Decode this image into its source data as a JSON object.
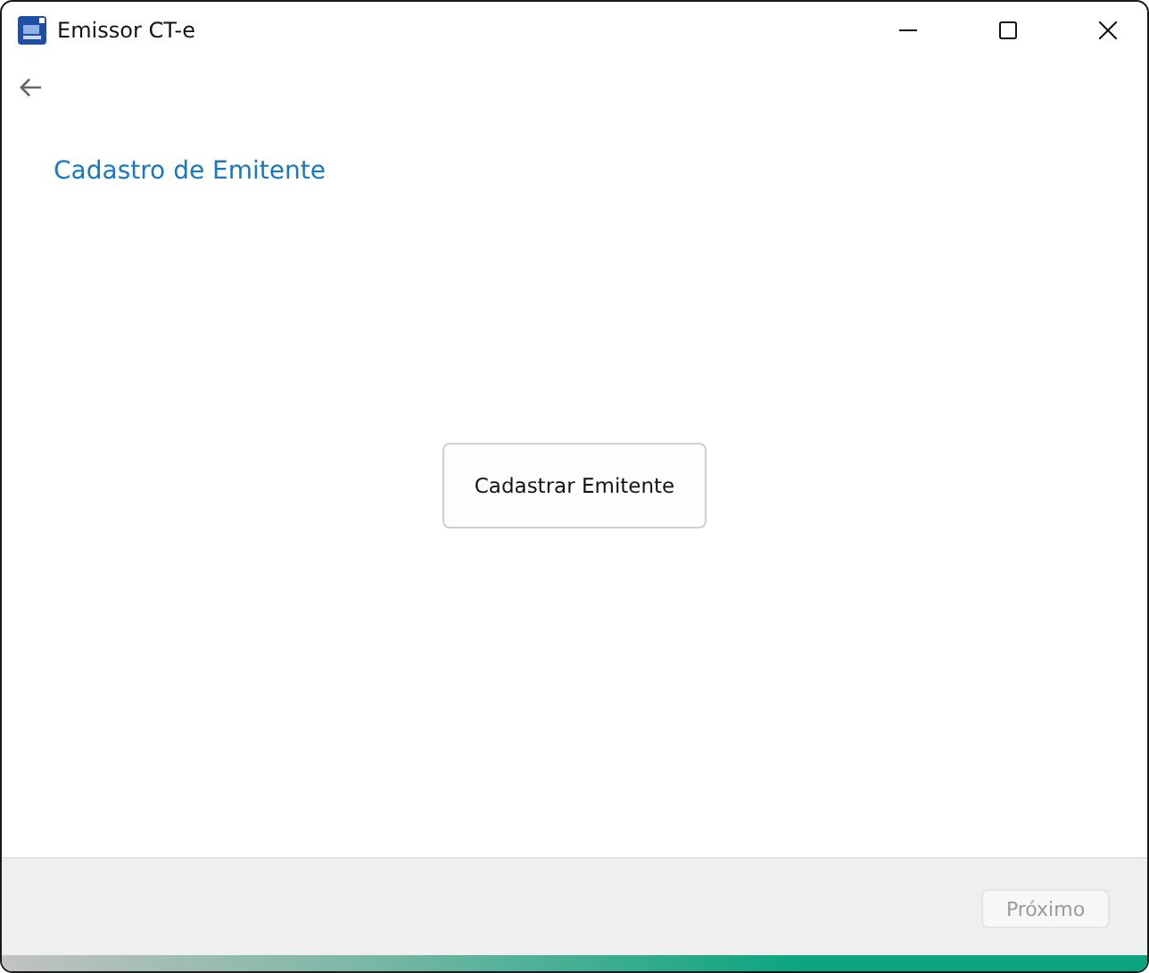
{
  "window": {
    "title": "Emissor CT-e"
  },
  "page": {
    "heading": "Cadastro de Emitente",
    "action_button": "Cadastrar Emitente"
  },
  "footer": {
    "next_button": {
      "label": "Próximo",
      "disabled": true
    }
  }
}
